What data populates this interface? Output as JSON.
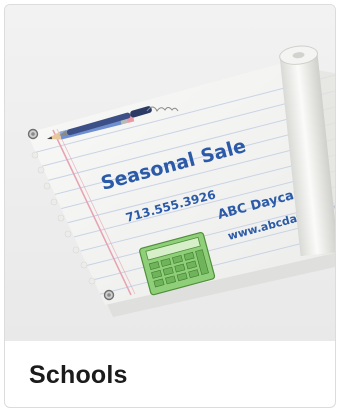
{
  "card": {
    "title": "Schools"
  },
  "banner": {
    "headline": "Seasonal Sale",
    "phone": "713.555.3926",
    "business": "ABC Daycare",
    "website": "www.abcdaycare.we",
    "colors": {
      "ink": "#2b5ba8",
      "paper": "#f6f6f4",
      "margin_line": "#e6a2b2",
      "rule_line": "#c9d3e6",
      "calculator": "#8fcf7a"
    }
  },
  "icons": [
    "pencil-icon",
    "pen-icon",
    "calculator-icon"
  ]
}
